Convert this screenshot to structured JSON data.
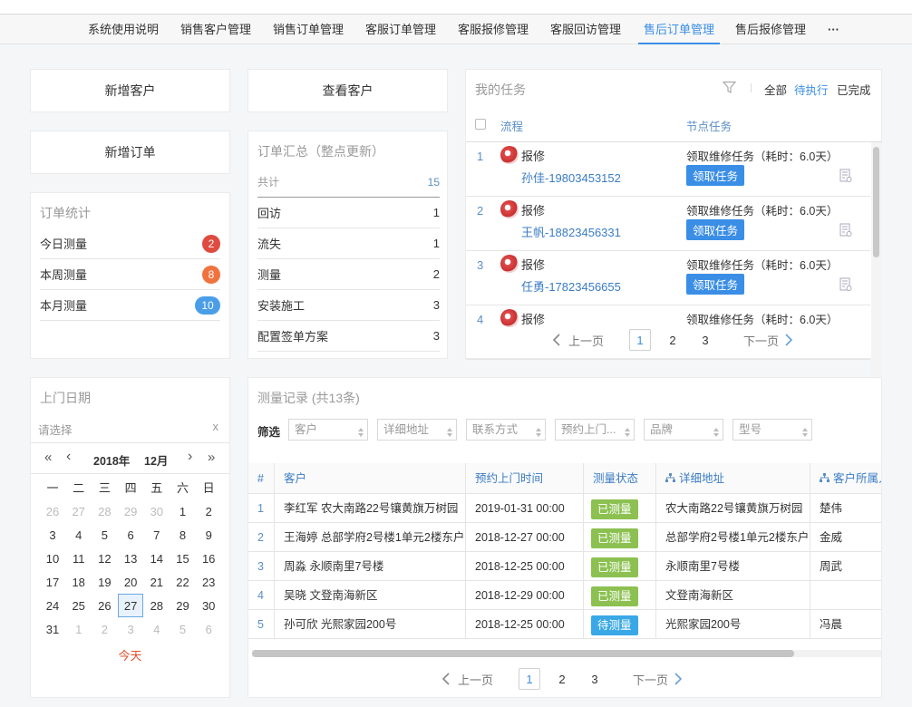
{
  "nav": {
    "items": [
      "系统使用说明",
      "销售客户管理",
      "销售订单管理",
      "客服订单管理",
      "客服报修管理",
      "客服回访管理",
      "售后订单管理",
      "售后报修管理"
    ],
    "active_index": 6,
    "more_label": "···"
  },
  "colors": {
    "accent": "#3a8ee6",
    "badge_day": "#e04b3f",
    "badge_week": "#f0733f",
    "badge_month": "#4a9ee8",
    "status_done": "#8cc152",
    "status_wait": "#3aa8e6",
    "today_text": "#e0522f"
  },
  "quick": {
    "add_customer": "新增客户",
    "view_customer": "查看客户",
    "add_order": "新增订单"
  },
  "stats": {
    "title": "订单统计",
    "rows": [
      {
        "label": "今日测量",
        "count": "2"
      },
      {
        "label": "本周测量",
        "count": "8"
      },
      {
        "label": "本月测量",
        "count": "10"
      }
    ]
  },
  "summary": {
    "title": "订单汇总（整点更新）",
    "total_label": "共计",
    "total_value": "15",
    "rows": [
      {
        "label": "回访",
        "value": "1"
      },
      {
        "label": "流失",
        "value": "1"
      },
      {
        "label": "测量",
        "value": "2"
      },
      {
        "label": "安装施工",
        "value": "3"
      },
      {
        "label": "配置签单方案",
        "value": "3"
      }
    ]
  },
  "tasks": {
    "title": "我的任务",
    "filters": [
      "全部",
      "待执行",
      "已完成"
    ],
    "active_filter": 1,
    "col_flow": "流程",
    "col_node": "节点任务",
    "rows": [
      {
        "num": "1",
        "type": "报修",
        "person": "孙佳-19803453152",
        "node": "领取维修任务（耗时：6.0天）",
        "action": "领取任务"
      },
      {
        "num": "2",
        "type": "报修",
        "person": "王帆-18823456331",
        "node": "领取维修任务（耗时：6.0天）",
        "action": "领取任务"
      },
      {
        "num": "3",
        "type": "报修",
        "person": "任勇-17823456655",
        "node": "领取维修任务（耗时：6.0天）",
        "action": "领取任务"
      },
      {
        "num": "4",
        "type": "报修",
        "person": "",
        "node": "领取维修任务（耗时：6.0天）",
        "action": ""
      }
    ],
    "pager": {
      "prev": "上一页",
      "next": "下一页",
      "pages": [
        "1",
        "2",
        "3"
      ],
      "current": "1"
    }
  },
  "calendar": {
    "title": "上门日期",
    "placeholder": "请选择",
    "clear": "x",
    "year_label": "2018年",
    "month_label": "12月",
    "nav_prev_year": "«",
    "nav_prev_month": "‹",
    "nav_next_month": "›",
    "nav_next_year": "»",
    "weekdays": [
      "一",
      "二",
      "三",
      "四",
      "五",
      "六",
      "日"
    ],
    "days": [
      [
        "26",
        "27",
        "28",
        "29",
        "30",
        "1",
        "2"
      ],
      [
        "3",
        "4",
        "5",
        "6",
        "7",
        "8",
        "9"
      ],
      [
        "10",
        "11",
        "12",
        "13",
        "14",
        "15",
        "16"
      ],
      [
        "17",
        "18",
        "19",
        "20",
        "21",
        "22",
        "23"
      ],
      [
        "24",
        "25",
        "26",
        "27",
        "28",
        "29",
        "30"
      ],
      [
        "31",
        "1",
        "2",
        "3",
        "4",
        "5",
        "6"
      ]
    ],
    "selected": "27",
    "today_label": "今天"
  },
  "records": {
    "title": "测量记录 (共13条)",
    "filter_label": "筛选",
    "filters": [
      "客户",
      "详细地址",
      "联系方式",
      "预约上门...",
      "品牌",
      "型号"
    ],
    "columns": [
      "#",
      "客户",
      "预约上门时间",
      "测量状态",
      "详细地址",
      "客户所属人"
    ],
    "rows": [
      {
        "num": "1",
        "customer": "李红军 农大南路22号镶黄旗万树园",
        "time": "2019-01-31 00:00",
        "status": "已测量",
        "address": "农大南路22号镶黄旗万树园",
        "owner": "楚伟"
      },
      {
        "num": "2",
        "customer": "王海婷 总部学府2号楼1单元2楼东户",
        "time": "2018-12-27 00:00",
        "status": "已测量",
        "address": "总部学府2号楼1单元2楼东户",
        "owner": "金威"
      },
      {
        "num": "3",
        "customer": "周淼 永顺南里7号楼",
        "time": "2018-12-25 00:00",
        "status": "已测量",
        "address": "永顺南里7号楼",
        "owner": "周武"
      },
      {
        "num": "4",
        "customer": "吴晓 文登南海新区",
        "time": "2018-12-29 00:00",
        "status": "已测量",
        "address": "文登南海新区",
        "owner": ""
      },
      {
        "num": "5",
        "customer": "孙可欣 光熙家园200号",
        "time": "2018-12-25 00:00",
        "status": "待测量",
        "address": "光熙家园200号",
        "owner": "冯晨"
      }
    ],
    "pager": {
      "prev": "上一页",
      "next": "下一页",
      "pages": [
        "1",
        "2",
        "3"
      ],
      "current": "1"
    }
  }
}
